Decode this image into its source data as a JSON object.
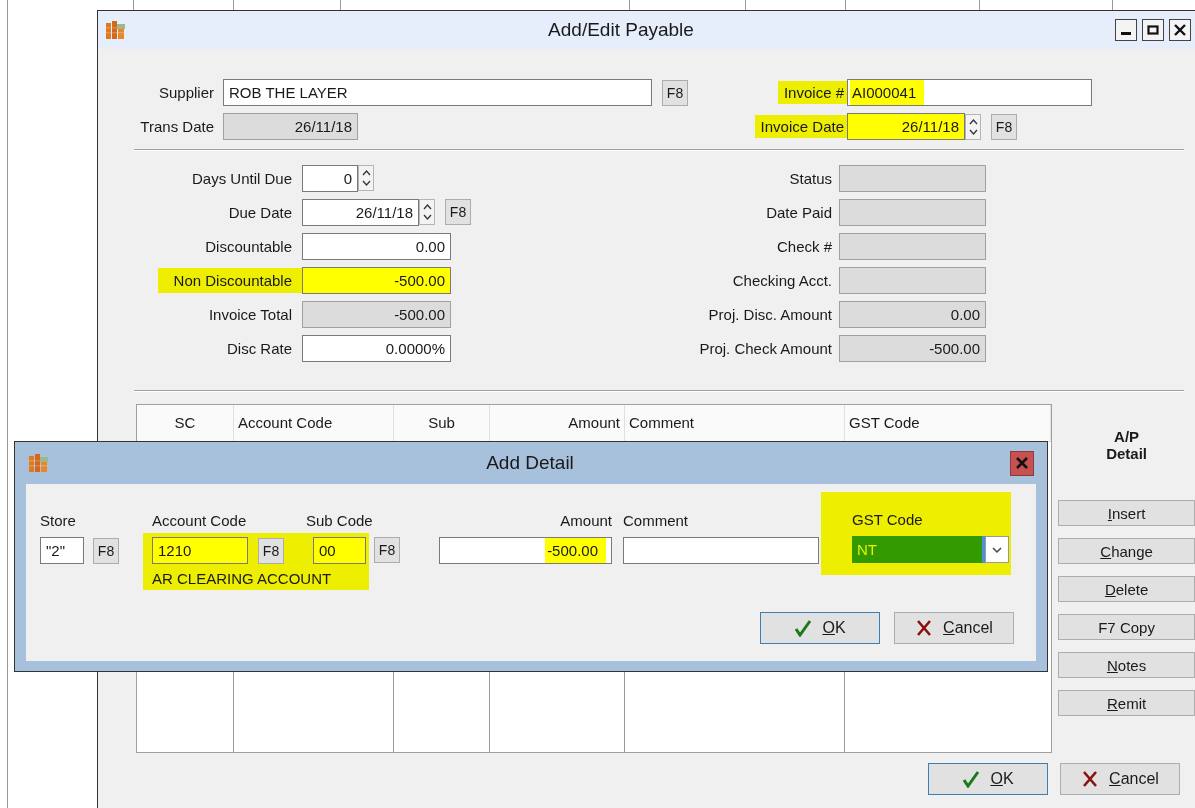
{
  "window": {
    "title": "Add/Edit Payable"
  },
  "header_left": [
    {
      "label": "Supplier",
      "value": "ROB THE LAYER",
      "kind": "input",
      "right_aligned": false,
      "button": "F8",
      "label_highlight": false,
      "field_highlight": false,
      "value_highlight": false
    },
    {
      "label": "Trans Date",
      "value": "26/11/18",
      "kind": "readonly",
      "right_aligned": true,
      "label_highlight": false,
      "field_highlight": false,
      "value_highlight": false
    }
  ],
  "header_right": [
    {
      "label": "Invoice #",
      "value": "AI000041",
      "kind": "input",
      "right_aligned": false,
      "label_highlight": true,
      "field_highlight": false,
      "value_highlight": true
    },
    {
      "label": "Invoice Date",
      "value": "26/11/18",
      "kind": "spin",
      "right_aligned": true,
      "button": "F8",
      "label_highlight": true,
      "field_highlight": true,
      "value_highlight": false
    }
  ],
  "details_left": [
    {
      "label": "Days Until Due",
      "value": "0",
      "kind": "spin",
      "right_aligned": true,
      "label_highlight": false,
      "field_highlight": false,
      "value_highlight": false
    },
    {
      "label": "Due Date",
      "value": "26/11/18",
      "kind": "spin",
      "right_aligned": true,
      "button": "F8",
      "label_highlight": false,
      "field_highlight": false,
      "value_highlight": false
    },
    {
      "label": "Discountable",
      "value": "0.00",
      "kind": "input",
      "right_aligned": true,
      "label_highlight": false,
      "field_highlight": false,
      "value_highlight": false
    },
    {
      "label": "Non Discountable",
      "value": "-500.00",
      "kind": "input",
      "right_aligned": true,
      "label_highlight": true,
      "field_highlight": true,
      "value_highlight": false
    },
    {
      "label": "Invoice Total",
      "value": "-500.00",
      "kind": "readonly",
      "right_aligned": true,
      "label_highlight": false,
      "field_highlight": false,
      "value_highlight": false
    },
    {
      "label": "Disc Rate",
      "value": "0.0000%",
      "kind": "input",
      "right_aligned": true,
      "label_highlight": false,
      "field_highlight": false,
      "value_highlight": false
    }
  ],
  "details_right": [
    {
      "label": "Status",
      "kind": "readonly",
      "label_highlight": false,
      "field_highlight": false
    },
    {
      "label": "Date Paid",
      "kind": "readonly",
      "label_highlight": false,
      "field_highlight": false
    },
    {
      "label": "Check #",
      "kind": "readonly",
      "label_highlight": false,
      "field_highlight": false
    },
    {
      "label": "Checking Acct.",
      "kind": "readonly",
      "label_highlight": false,
      "field_highlight": false
    },
    {
      "label": "Proj. Disc. Amount",
      "value": "0.00",
      "kind": "readonly",
      "right_aligned": true,
      "label_highlight": false,
      "field_highlight": false,
      "value_highlight": false
    },
    {
      "label": "Proj. Check Amount",
      "value": "-500.00",
      "kind": "readonly",
      "right_aligned": true,
      "label_highlight": false,
      "field_highlight": false,
      "value_highlight": false
    }
  ],
  "table": {
    "columns": [
      {
        "label": "SC",
        "centered": true,
        "right_aligned": false
      },
      {
        "label": "Account Code",
        "centered": false,
        "right_aligned": false
      },
      {
        "label": "Sub",
        "centered": true,
        "right_aligned": false
      },
      {
        "label": "Amount",
        "centered": false,
        "right_aligned": true
      },
      {
        "label": "Comment",
        "centered": false,
        "right_aligned": false
      },
      {
        "label": "GST Code",
        "centered": false,
        "right_aligned": false
      }
    ]
  },
  "side_panel": {
    "title": "A/P Detail",
    "buttons": [
      {
        "label": "Insert",
        "mnemonic": true
      },
      {
        "label": "Change",
        "mnemonic": true
      },
      {
        "label": "Delete",
        "mnemonic": true
      },
      {
        "label": "F7 Copy",
        "mnemonic": false
      },
      {
        "label": "Notes",
        "mnemonic": true
      },
      {
        "label": "Remit",
        "mnemonic": true
      }
    ]
  },
  "buttons": [
    {
      "label": "OK",
      "kind": "ok",
      "mnemonic": true,
      "default": true
    },
    {
      "label": "Cancel",
      "kind": "cancel",
      "mnemonic": true,
      "default": false
    }
  ],
  "dialog": {
    "title": "Add Detail",
    "store": {
      "label": "Store",
      "value": "\"2\"",
      "button": "F8"
    },
    "account_code": {
      "label": "Account Code",
      "value": "1210",
      "button": "F8"
    },
    "sub_code": {
      "label": "Sub Code",
      "value": "00",
      "button": "F8"
    },
    "account_name": "AR CLEARING ACCOUNT",
    "account_highlight": true,
    "amount": {
      "label": "Amount",
      "value": "-500.00",
      "right_aligned": true,
      "value_highlight": true
    },
    "comment": {
      "label": "Comment"
    },
    "gst_code": {
      "label": "GST Code",
      "value": "NT",
      "highlight": true
    },
    "buttons": [
      {
        "label": "OK",
        "kind": "ok",
        "mnemonic": true,
        "default": true
      },
      {
        "label": "Cancel",
        "kind": "cancel",
        "mnemonic": true,
        "default": false
      }
    ]
  }
}
